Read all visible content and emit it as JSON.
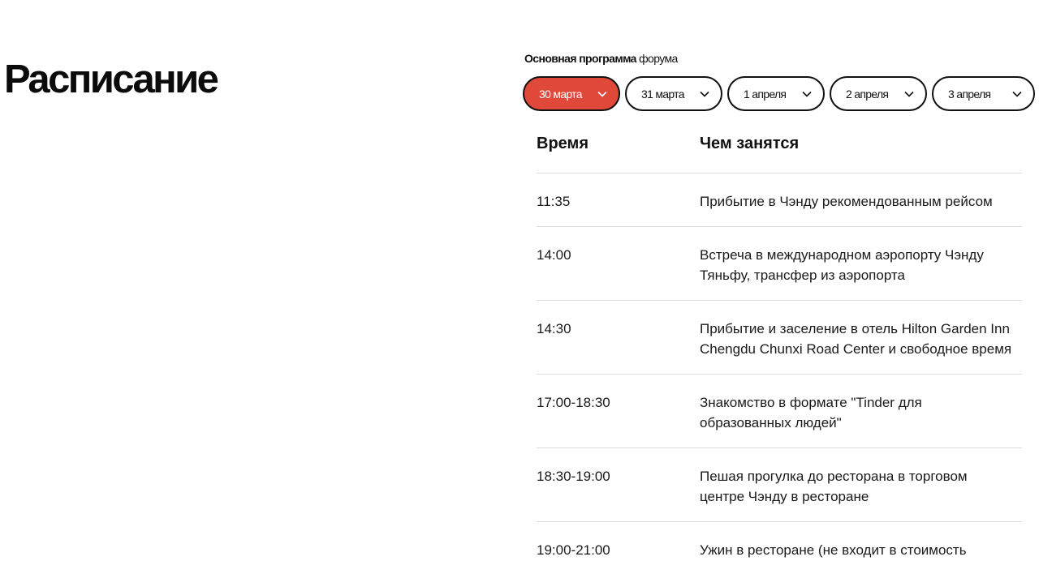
{
  "page": {
    "title": "Расписание"
  },
  "program": {
    "label_bold": "Основная программа",
    "label_rest": " форума"
  },
  "day_tabs": [
    {
      "label": "30 марта",
      "active": true
    },
    {
      "label": "31 марта",
      "active": false
    },
    {
      "label": "1 апреля",
      "active": false
    },
    {
      "label": "2 апреля",
      "active": false
    },
    {
      "label": "3 апреля",
      "active": false
    }
  ],
  "schedule": {
    "columns": [
      "Время",
      "Чем занятся"
    ],
    "rows": [
      {
        "time": "11:35",
        "activity": "Прибытие в Чэнду рекомендованным рейсом"
      },
      {
        "time": "14:00",
        "activity": "Встреча в международном аэропорту Чэнду Тяньфу, трансфер из аэропорта"
      },
      {
        "time": "14:30",
        "activity": "Прибытие и заселение в отель Hilton Garden Inn Chengdu Chunxi Road Center и свободное время"
      },
      {
        "time": "17:00-18:30",
        "activity": "Знакомство в формате \"Tinder для образованных людей\""
      },
      {
        "time": "18:30-19:00",
        "activity": "Пешая прогулка до ресторана в торговом центре Чэнду в ресторане"
      },
      {
        "time": "19:00-21:00",
        "activity": "Ужин в ресторане (не входит в стоимость"
      }
    ]
  },
  "colors": {
    "accent": "#e0483a",
    "text": "#111111",
    "divider": "#dcdcdc"
  },
  "icons": {
    "tab_dropdown": "chevron-down-icon"
  }
}
